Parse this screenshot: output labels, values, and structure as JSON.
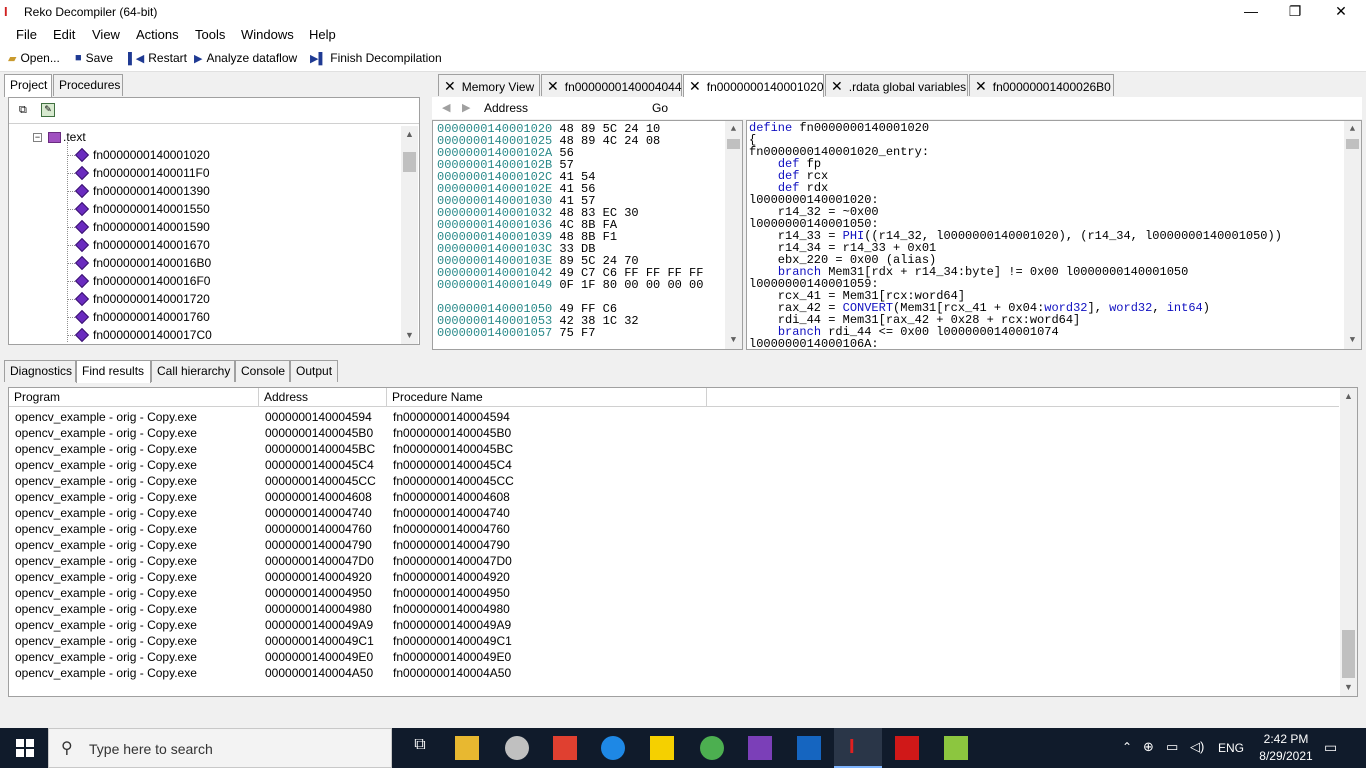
{
  "window": {
    "title": "Reko Decompiler (64-bit)",
    "minimize": "—",
    "restore": "❐",
    "close": "✕"
  },
  "menu": [
    "File",
    "Edit",
    "View",
    "Actions",
    "Tools",
    "Windows",
    "Help"
  ],
  "toolbar": {
    "open": "Open...",
    "save": "Save",
    "restart": "Restart",
    "analyze": "Analyze dataflow",
    "finish": "Finish Decompilation"
  },
  "left_tabs": [
    "Project",
    "Procedures"
  ],
  "tree": {
    "section": ".text",
    "items": [
      "fn0000000140001020",
      "fn00000001400011F0",
      "fn0000000140001390",
      "fn0000000140001550",
      "fn0000000140001590",
      "fn0000000140001670",
      "fn00000001400016B0",
      "fn00000001400016F0",
      "fn0000000140001720",
      "fn0000000140001760",
      "fn00000001400017C0"
    ]
  },
  "doc_tabs": [
    "Memory View",
    "fn0000000140004044",
    "fn0000000140001020",
    ".rdata global variables",
    "fn00000001400026B0"
  ],
  "nav": {
    "address_label": "Address",
    "go_label": "Go"
  },
  "disasm": [
    {
      "a": "0000000140001020",
      "b": "48 89 5C 24 10"
    },
    {
      "a": "0000000140001025",
      "b": "48 89 4C 24 08"
    },
    {
      "a": "000000014000102A",
      "b": "56"
    },
    {
      "a": "000000014000102B",
      "b": "57"
    },
    {
      "a": "000000014000102C",
      "b": "41 54"
    },
    {
      "a": "000000014000102E",
      "b": "41 56"
    },
    {
      "a": "0000000140001030",
      "b": "41 57"
    },
    {
      "a": "0000000140001032",
      "b": "48 83 EC 30"
    },
    {
      "a": "0000000140001036",
      "b": "4C 8B FA"
    },
    {
      "a": "0000000140001039",
      "b": "48 8B F1"
    },
    {
      "a": "000000014000103C",
      "b": "33 DB"
    },
    {
      "a": "000000014000103E",
      "b": "89 5C 24 70"
    },
    {
      "a": "0000000140001042",
      "b": "49 C7 C6 FF FF FF FF"
    },
    {
      "a": "0000000140001049",
      "b": "0F 1F 80 00 00 00 00"
    },
    {
      "a": "",
      "b": ""
    },
    {
      "a": "0000000140001050",
      "b": "49 FF C6"
    },
    {
      "a": "0000000140001053",
      "b": "42 38 1C 32"
    },
    {
      "a": "0000000140001057",
      "b": "75 F7"
    }
  ],
  "code": [
    "define fn0000000140001020",
    "{",
    "fn0000000140001020_entry:",
    "    def fp",
    "    def rcx",
    "    def rdx",
    "l0000000140001020:",
    "    r14_32 = ~0x00",
    "l0000000140001050:",
    "    r14_33 = PHI((r14_32, l0000000140001020), (r14_34, l0000000140001050))",
    "    r14_34 = r14_33 + 0x01",
    "    ebx_220 = 0x00 (alias)",
    "    branch Mem31[rdx + r14_34:byte] != 0x00 l0000000140001050",
    "l0000000140001059:",
    "    rcx_41 = Mem31[rcx:word64]",
    "    rax_42 = CONVERT(Mem31[rcx_41 + 0x04:word32], word32, int64)",
    "    rdi_44 = Mem31[rax_42 + 0x28 + rcx:word64]",
    "    branch rdi_44 <= 0x00 l0000000140001074",
    "l000000014000106A:"
  ],
  "bottom_tabs": [
    "Diagnostics",
    "Find results",
    "Call hierarchy",
    "Console",
    "Output"
  ],
  "results": {
    "columns": [
      "Program",
      "Address",
      "Procedure Name"
    ],
    "rows": [
      [
        "opencv_example - orig - Copy.exe",
        "0000000140004594",
        "fn0000000140004594"
      ],
      [
        "opencv_example - orig - Copy.exe",
        "00000001400045B0",
        "fn00000001400045B0"
      ],
      [
        "opencv_example - orig - Copy.exe",
        "00000001400045BC",
        "fn00000001400045BC"
      ],
      [
        "opencv_example - orig - Copy.exe",
        "00000001400045C4",
        "fn00000001400045C4"
      ],
      [
        "opencv_example - orig - Copy.exe",
        "00000001400045CC",
        "fn00000001400045CC"
      ],
      [
        "opencv_example - orig - Copy.exe",
        "0000000140004608",
        "fn0000000140004608"
      ],
      [
        "opencv_example - orig - Copy.exe",
        "0000000140004740",
        "fn0000000140004740"
      ],
      [
        "opencv_example - orig - Copy.exe",
        "0000000140004760",
        "fn0000000140004760"
      ],
      [
        "opencv_example - orig - Copy.exe",
        "0000000140004790",
        "fn0000000140004790"
      ],
      [
        "opencv_example - orig - Copy.exe",
        "00000001400047D0",
        "fn00000001400047D0"
      ],
      [
        "opencv_example - orig - Copy.exe",
        "0000000140004920",
        "fn0000000140004920"
      ],
      [
        "opencv_example - orig - Copy.exe",
        "0000000140004950",
        "fn0000000140004950"
      ],
      [
        "opencv_example - orig - Copy.exe",
        "0000000140004980",
        "fn0000000140004980"
      ],
      [
        "opencv_example - orig - Copy.exe",
        "00000001400049A9",
        "fn00000001400049A9"
      ],
      [
        "opencv_example - orig - Copy.exe",
        "00000001400049C1",
        "fn00000001400049C1"
      ],
      [
        "opencv_example - orig - Copy.exe",
        "00000001400049E0",
        "fn00000001400049E0"
      ],
      [
        "opencv_example - orig - Copy.exe",
        "0000000140004A50",
        "fn0000000140004A50"
      ]
    ]
  },
  "taskbar": {
    "search_placeholder": "Type here to search",
    "time": "2:42 PM",
    "date": "8/29/2021",
    "lang": "ENG"
  }
}
